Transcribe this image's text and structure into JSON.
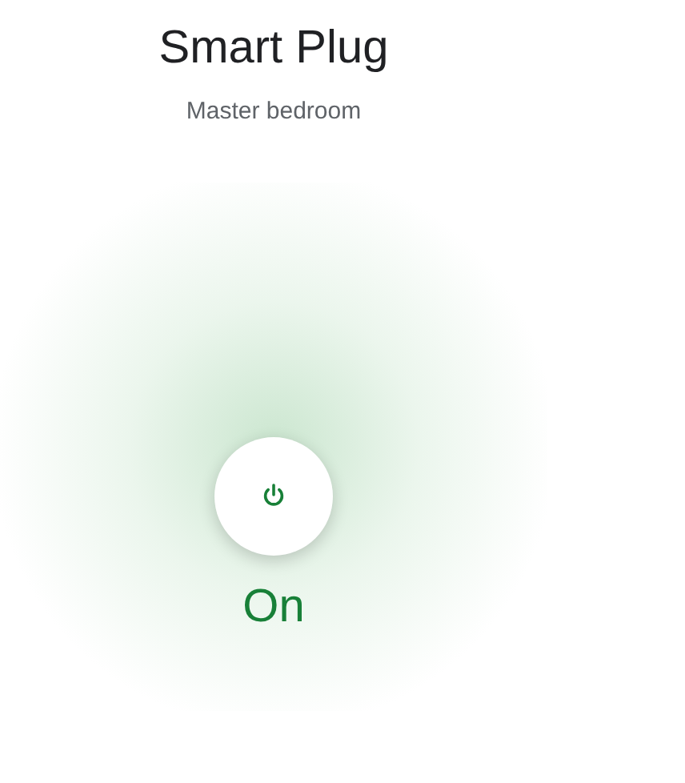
{
  "device": {
    "name": "Smart Plug",
    "room": "Master bedroom"
  },
  "power": {
    "on": true,
    "label": "On"
  }
}
